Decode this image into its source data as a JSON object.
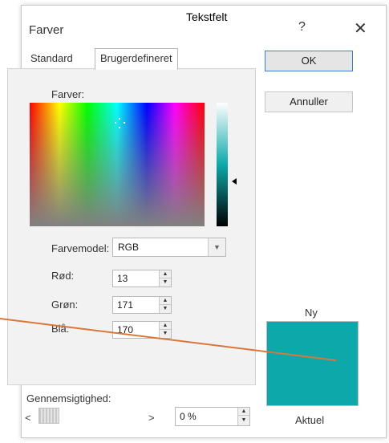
{
  "dialog": {
    "title": "Farver",
    "overlay_label": "Tekstfelt",
    "help_glyph": "?",
    "close_glyph": "✕"
  },
  "tabs": [
    {
      "label": "Standard",
      "selected": false
    },
    {
      "label": "Brugerdefineret",
      "selected": true
    }
  ],
  "colors_label": "Farver:",
  "color_model": {
    "label": "Farvemodel:",
    "value": "RGB"
  },
  "channels": {
    "red": {
      "label": "Rød:",
      "value": "13"
    },
    "green": {
      "label": "Grøn:",
      "value": "171"
    },
    "blue": {
      "label": "Blå:",
      "value": "170"
    }
  },
  "buttons": {
    "ok": "OK",
    "cancel": "Annuller"
  },
  "preview": {
    "new_label": "Ny",
    "current_label": "Aktuel",
    "color": "#0da9aa"
  },
  "transparency": {
    "label": "Gennemsigtighed:",
    "value": "0 %",
    "left_glyph": "<",
    "right_glyph": ">"
  },
  "annotation_color": "#d9773a"
}
